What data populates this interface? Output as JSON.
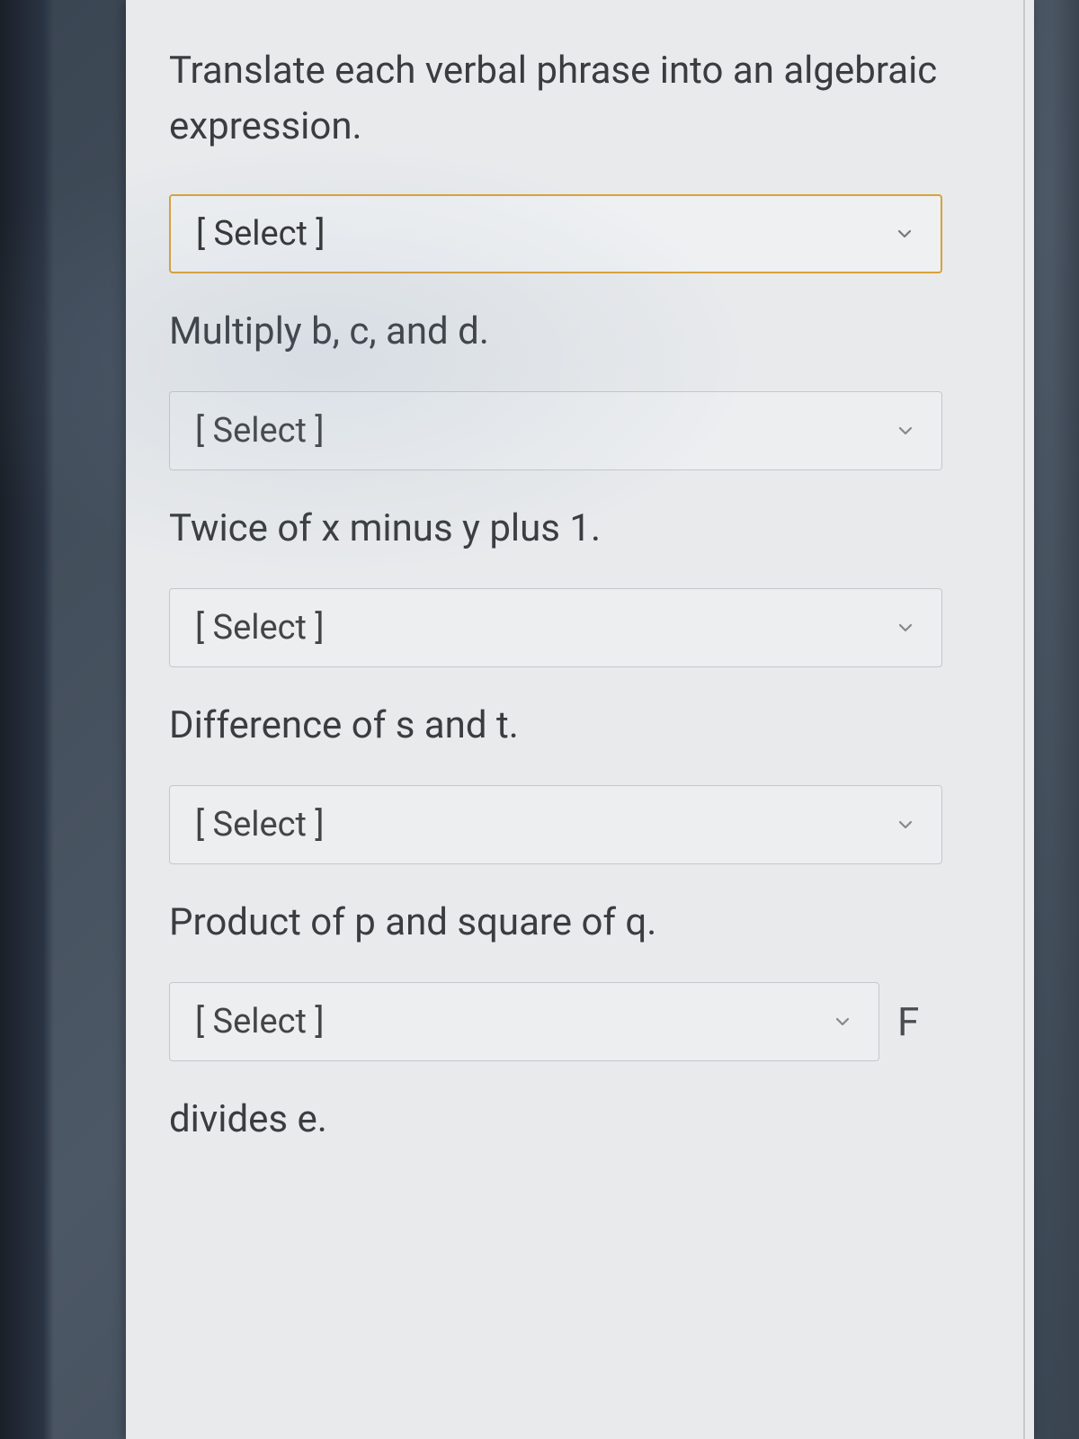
{
  "instruction": "Translate each verbal phrase into an algebraic expression.",
  "select_placeholder": "[ Select ]",
  "items": [
    {
      "prompt": "Multiply b, c, and d."
    },
    {
      "prompt": "Twice of x minus y plus 1."
    },
    {
      "prompt": "Difference of s and t."
    },
    {
      "prompt": "Product of p and square of q."
    },
    {
      "prompt": "divides e."
    }
  ],
  "trailing_letter": "F",
  "colors": {
    "highlight_border": "#d9a23a",
    "card_bg": "#e8eaec",
    "text": "#3a3d40"
  }
}
